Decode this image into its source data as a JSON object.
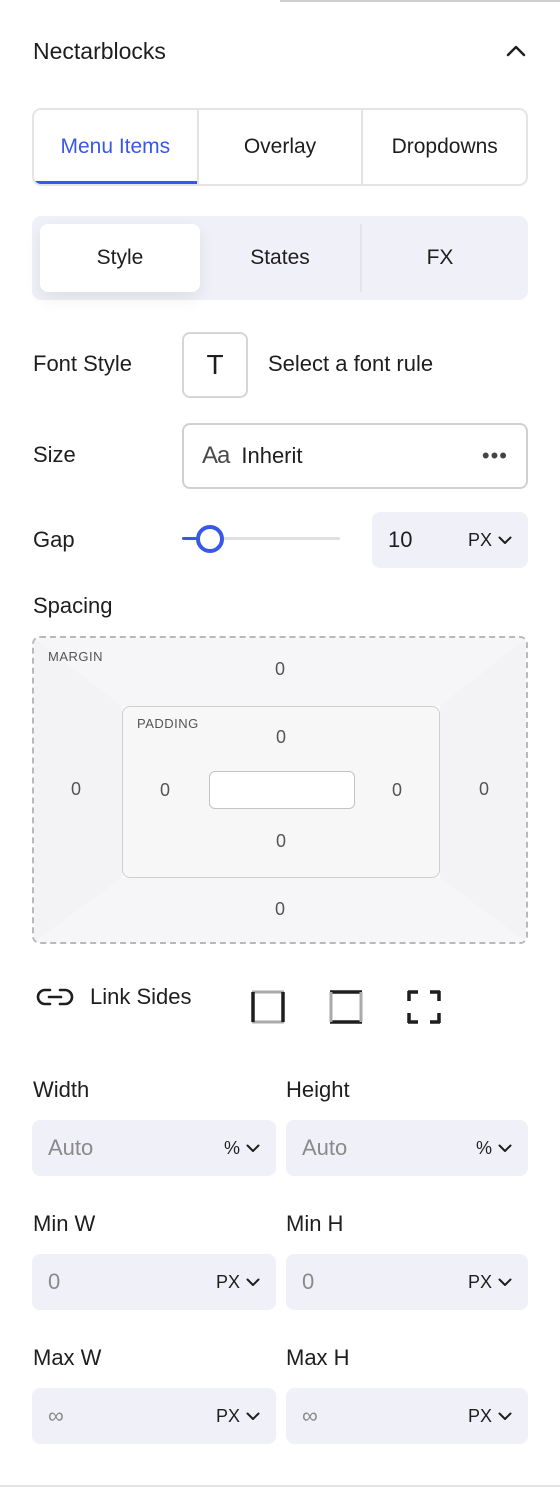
{
  "panel": {
    "title": "Nectarblocks"
  },
  "tabs": [
    "Menu Items",
    "Overlay",
    "Dropdowns"
  ],
  "sub_tabs": [
    "Style",
    "States",
    "FX"
  ],
  "font_style": {
    "label": "Font Style",
    "button_glyph": "T",
    "placeholder": "Select a font rule"
  },
  "size": {
    "label": "Size",
    "glyph": "Aa",
    "value": "Inherit",
    "more": "•••"
  },
  "gap": {
    "label": "Gap",
    "value": "10",
    "unit": "PX",
    "slider_level": 0.18
  },
  "spacing": {
    "label": "Spacing",
    "margin_label": "MARGIN",
    "padding_label": "PADDING",
    "margin": {
      "top": "0",
      "right": "0",
      "bottom": "0",
      "left": "0"
    },
    "padding": {
      "top": "0",
      "right": "0",
      "bottom": "0",
      "left": "0"
    }
  },
  "link_sides": {
    "label": "Link Sides"
  },
  "width": {
    "label": "Width",
    "placeholder": "Auto",
    "unit": "%"
  },
  "height": {
    "label": "Height",
    "placeholder": "Auto",
    "unit": "%"
  },
  "min_w": {
    "label": "Min W",
    "placeholder": "0",
    "unit": "PX"
  },
  "min_h": {
    "label": "Min H",
    "placeholder": "0",
    "unit": "PX"
  },
  "max_w": {
    "label": "Max W",
    "placeholder": "∞",
    "unit": "PX"
  },
  "max_h": {
    "label": "Max H",
    "placeholder": "∞",
    "unit": "PX"
  },
  "colors": {
    "accent": "#3858e9",
    "field_bg": "#f0f0f8",
    "text": "#1e1e1e"
  }
}
